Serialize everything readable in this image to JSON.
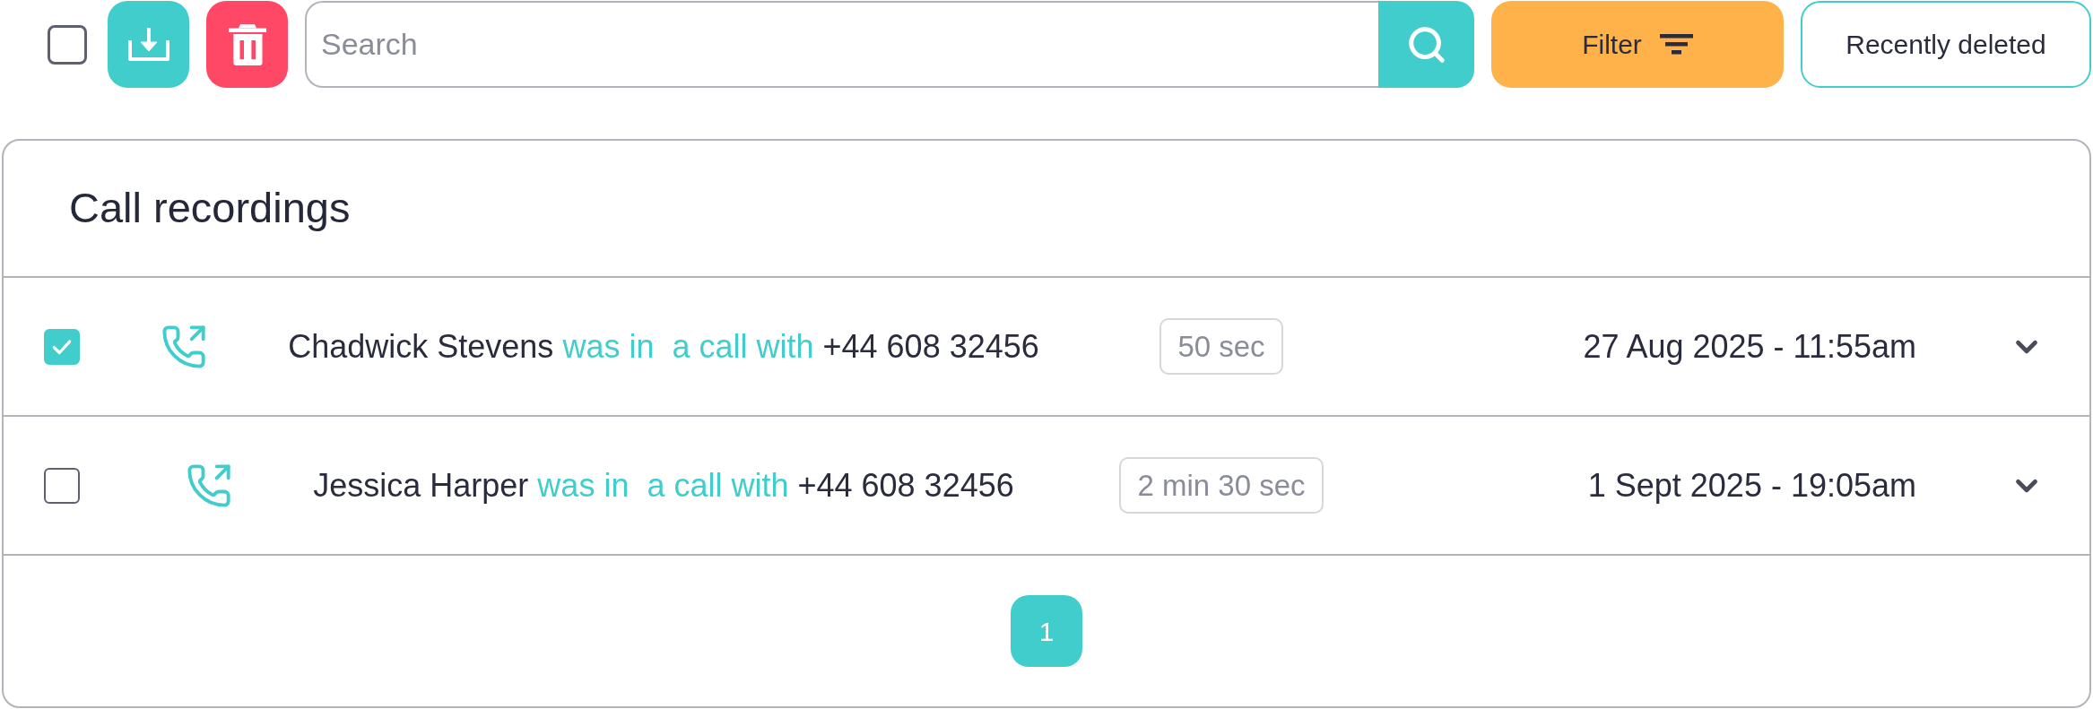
{
  "toolbar": {
    "select_all": {
      "checked": false
    },
    "search": {
      "placeholder": "Search"
    },
    "filter_button": {
      "label": "Filter"
    },
    "recently_deleted_button": {
      "label": "Recently deleted"
    }
  },
  "panel": {
    "title": "Call recordings",
    "rows": [
      {
        "selected": true,
        "caller": "Chadwick Stevens",
        "action": "was in  a call with",
        "other_party": "+44 608 32456",
        "duration": "50 sec",
        "date_time": "27 Aug 2025 - 11:55am",
        "expanded": false
      },
      {
        "selected": false,
        "caller": "Jessica Harper",
        "action": "was in  a call with",
        "other_party": "+44 608 32456",
        "duration": "2 min 30 sec",
        "date_time": "1 Sept 2025 - 19:05am",
        "expanded": false
      }
    ],
    "pagination": [
      {
        "label": "1",
        "selected": true
      }
    ]
  }
}
